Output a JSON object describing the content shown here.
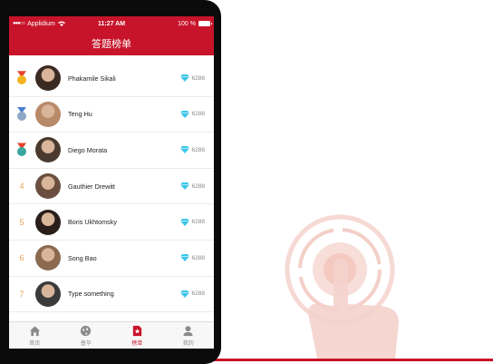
{
  "status_bar": {
    "carrier": "Applidium",
    "time": "11:27 AM",
    "battery": "100 %"
  },
  "nav": {
    "title": "答题榜单"
  },
  "leaderboard": [
    {
      "rank": "",
      "medal": "gold",
      "name": "Phakamile Sikali",
      "score": "6288",
      "avatar_color": "#3a2a22"
    },
    {
      "rank": "",
      "medal": "silver",
      "name": "Teng Hu",
      "score": "6288",
      "avatar_color": "#b88a6a"
    },
    {
      "rank": "",
      "medal": "bronze",
      "name": "Diego Morata",
      "score": "6288",
      "avatar_color": "#4a3a30"
    },
    {
      "rank": "4",
      "medal": "",
      "name": "Gauthier Drewitt",
      "score": "6288",
      "avatar_color": "#6b4e40"
    },
    {
      "rank": "5",
      "medal": "",
      "name": "Boris Ukhtomsky",
      "score": "6288",
      "avatar_color": "#2a1e1a"
    },
    {
      "rank": "6",
      "medal": "",
      "name": "Song Bao",
      "score": "6288",
      "avatar_color": "#8a6a50"
    },
    {
      "rank": "7",
      "medal": "",
      "name": "Type something",
      "score": "6288",
      "avatar_color": "#3a3a3a"
    }
  ],
  "tabs": [
    {
      "label": "首页",
      "icon": "home-icon"
    },
    {
      "label": "普华",
      "icon": "globe-icon"
    },
    {
      "label": "榜单",
      "icon": "ranking-icon",
      "active": true
    },
    {
      "label": "我的",
      "icon": "profile-icon"
    }
  ],
  "colors": {
    "accent": "#c8142a",
    "gold": "#f2b521",
    "silver": "#8fa8c8",
    "bronze": "#3aa6a0",
    "rank_text": "#e8a35a",
    "gem": "#3cc6e8"
  }
}
